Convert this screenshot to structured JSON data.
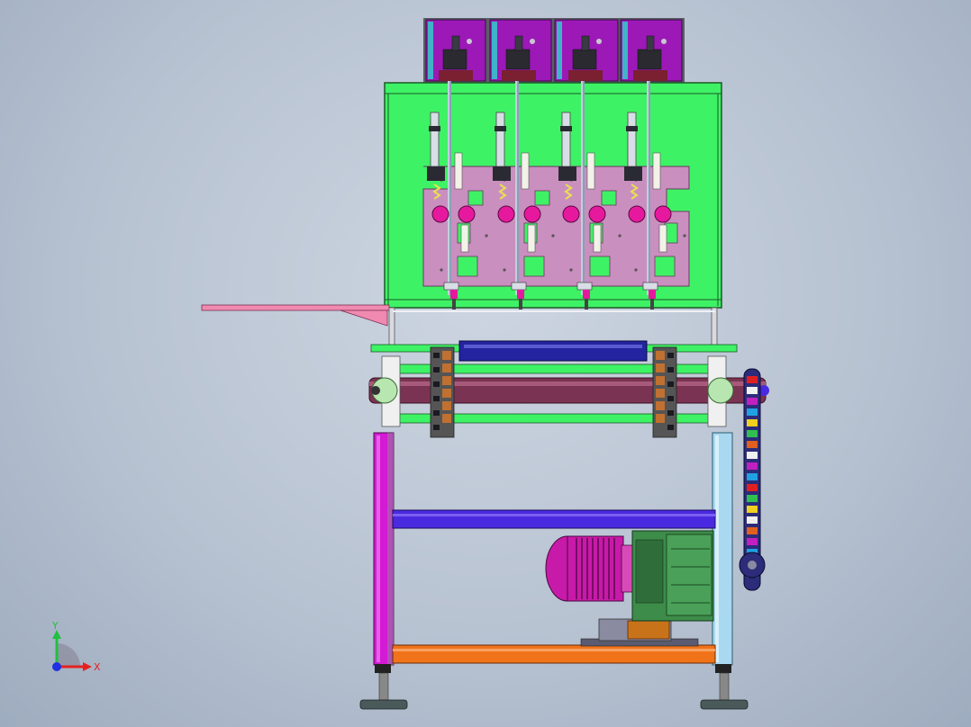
{
  "viewport": {
    "background": "#b8c3d2",
    "model": "machine-front-view"
  },
  "colors": {
    "top_boxes": "#9c19b8",
    "panel": "#3ef265",
    "plate": "#c98fbf",
    "knob": "#e6199e",
    "frame_left": "#d41ad4",
    "frame_right": "#a9d9f0",
    "crossbar_blue": "#4a2ae0",
    "crossbar_orange": "#f0731a",
    "roller": "#7a3352",
    "motor": "#c81aa8",
    "gearbox": "#3d8c4a",
    "chain_sprocket": "#2c2c7a",
    "feed_tray": "#f08ab0",
    "axis_x": "#e62020",
    "axis_y": "#20c040",
    "axis_z": "#2030e0"
  },
  "axis_triad": {
    "x_label": "X",
    "y_label": "Y"
  }
}
